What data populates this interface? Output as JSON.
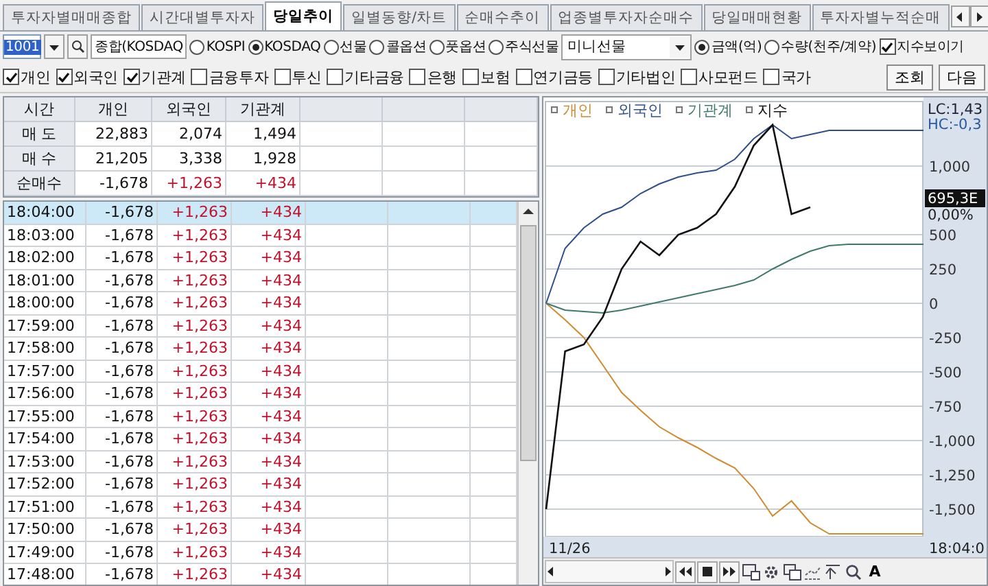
{
  "tabs": [
    {
      "label": "투자자별매매종합",
      "selected": false
    },
    {
      "label": "시간대별투자자",
      "selected": false
    },
    {
      "label": "당일추이",
      "selected": true
    },
    {
      "label": "일별동향/차트",
      "selected": false
    },
    {
      "label": "순매수추이",
      "selected": false
    },
    {
      "label": "업종별투자자순매수",
      "selected": false
    },
    {
      "label": "당일매매현황",
      "selected": false
    },
    {
      "label": "투자자별누적순매",
      "selected": false
    }
  ],
  "query": {
    "code": "1001",
    "market_name": "종합(KOSDAQ",
    "markets": [
      {
        "label": "KOSPI",
        "selected": false
      },
      {
        "label": "KOSDAQ",
        "selected": true
      },
      {
        "label": "선물",
        "selected": false
      },
      {
        "label": "콜옵션",
        "selected": false
      },
      {
        "label": "풋옵션",
        "selected": false
      },
      {
        "label": "주식선물",
        "selected": false
      }
    ],
    "product": "미니선물",
    "units": [
      {
        "label": "금액(억)",
        "selected": true
      },
      {
        "label": "수량(천주/계약)",
        "selected": false
      }
    ],
    "show_index": {
      "label": "지수보이기",
      "checked": true
    }
  },
  "investors": [
    {
      "label": "개인",
      "checked": true
    },
    {
      "label": "외국인",
      "checked": true
    },
    {
      "label": "기관계",
      "checked": true
    },
    {
      "label": "금융투자",
      "checked": false
    },
    {
      "label": "투신",
      "checked": false
    },
    {
      "label": "기타금융",
      "checked": false
    },
    {
      "label": "은행",
      "checked": false
    },
    {
      "label": "보험",
      "checked": false
    },
    {
      "label": "연기금등",
      "checked": false
    },
    {
      "label": "기타법인",
      "checked": false
    },
    {
      "label": "사모펀드",
      "checked": false
    },
    {
      "label": "국가",
      "checked": false
    }
  ],
  "buttons": [
    "조회",
    "다음"
  ],
  "summary": {
    "columns": [
      "시간",
      "개인",
      "외국인",
      "기관계"
    ],
    "rows": [
      {
        "label": "매 도",
        "values": [
          {
            "text": "22,883",
            "color": "#111111"
          },
          {
            "text": "2,074",
            "color": "#111111"
          },
          {
            "text": "1,494",
            "color": "#111111"
          }
        ]
      },
      {
        "label": "매 수",
        "values": [
          {
            "text": "21,205",
            "color": "#111111"
          },
          {
            "text": "3,338",
            "color": "#111111"
          },
          {
            "text": "1,928",
            "color": "#111111"
          }
        ]
      },
      {
        "label": "순매수",
        "values": [
          {
            "text": "-1,678",
            "color": "#111111"
          },
          {
            "text": "+1,263",
            "color": "#c0102a"
          },
          {
            "text": "+434",
            "color": "#c0102a"
          }
        ]
      }
    ]
  },
  "timeline": [
    {
      "time": "18:04:00",
      "selected": true,
      "values": [
        {
          "text": "-1,678",
          "color": "#111111"
        },
        {
          "text": "+1,263",
          "color": "#c0102a"
        },
        {
          "text": "+434",
          "color": "#c0102a"
        }
      ]
    },
    {
      "time": "18:03:00",
      "selected": false,
      "values": [
        {
          "text": "-1,678",
          "color": "#111111"
        },
        {
          "text": "+1,263",
          "color": "#c0102a"
        },
        {
          "text": "+434",
          "color": "#c0102a"
        }
      ]
    },
    {
      "time": "18:02:00",
      "selected": false,
      "values": [
        {
          "text": "-1,678",
          "color": "#111111"
        },
        {
          "text": "+1,263",
          "color": "#c0102a"
        },
        {
          "text": "+434",
          "color": "#c0102a"
        }
      ]
    },
    {
      "time": "18:01:00",
      "selected": false,
      "values": [
        {
          "text": "-1,678",
          "color": "#111111"
        },
        {
          "text": "+1,263",
          "color": "#c0102a"
        },
        {
          "text": "+434",
          "color": "#c0102a"
        }
      ]
    },
    {
      "time": "18:00:00",
      "selected": false,
      "values": [
        {
          "text": "-1,678",
          "color": "#111111"
        },
        {
          "text": "+1,263",
          "color": "#c0102a"
        },
        {
          "text": "+434",
          "color": "#c0102a"
        }
      ]
    },
    {
      "time": "17:59:00",
      "selected": false,
      "values": [
        {
          "text": "-1,678",
          "color": "#111111"
        },
        {
          "text": "+1,263",
          "color": "#c0102a"
        },
        {
          "text": "+434",
          "color": "#c0102a"
        }
      ]
    },
    {
      "time": "17:58:00",
      "selected": false,
      "values": [
        {
          "text": "-1,678",
          "color": "#111111"
        },
        {
          "text": "+1,263",
          "color": "#c0102a"
        },
        {
          "text": "+434",
          "color": "#c0102a"
        }
      ]
    },
    {
      "time": "17:57:00",
      "selected": false,
      "values": [
        {
          "text": "-1,678",
          "color": "#111111"
        },
        {
          "text": "+1,263",
          "color": "#c0102a"
        },
        {
          "text": "+434",
          "color": "#c0102a"
        }
      ]
    },
    {
      "time": "17:56:00",
      "selected": false,
      "values": [
        {
          "text": "-1,678",
          "color": "#111111"
        },
        {
          "text": "+1,263",
          "color": "#c0102a"
        },
        {
          "text": "+434",
          "color": "#c0102a"
        }
      ]
    },
    {
      "time": "17:55:00",
      "selected": false,
      "values": [
        {
          "text": "-1,678",
          "color": "#111111"
        },
        {
          "text": "+1,263",
          "color": "#c0102a"
        },
        {
          "text": "+434",
          "color": "#c0102a"
        }
      ]
    },
    {
      "time": "17:54:00",
      "selected": false,
      "values": [
        {
          "text": "-1,678",
          "color": "#111111"
        },
        {
          "text": "+1,263",
          "color": "#c0102a"
        },
        {
          "text": "+434",
          "color": "#c0102a"
        }
      ]
    },
    {
      "time": "17:53:00",
      "selected": false,
      "values": [
        {
          "text": "-1,678",
          "color": "#111111"
        },
        {
          "text": "+1,263",
          "color": "#c0102a"
        },
        {
          "text": "+434",
          "color": "#c0102a"
        }
      ]
    },
    {
      "time": "17:52:00",
      "selected": false,
      "values": [
        {
          "text": "-1,678",
          "color": "#111111"
        },
        {
          "text": "+1,263",
          "color": "#c0102a"
        },
        {
          "text": "+434",
          "color": "#c0102a"
        }
      ]
    },
    {
      "time": "17:51:00",
      "selected": false,
      "values": [
        {
          "text": "-1,678",
          "color": "#111111"
        },
        {
          "text": "+1,263",
          "color": "#c0102a"
        },
        {
          "text": "+434",
          "color": "#c0102a"
        }
      ]
    },
    {
      "time": "17:50:00",
      "selected": false,
      "values": [
        {
          "text": "-1,678",
          "color": "#111111"
        },
        {
          "text": "+1,263",
          "color": "#c0102a"
        },
        {
          "text": "+434",
          "color": "#c0102a"
        }
      ]
    },
    {
      "time": "17:49:00",
      "selected": false,
      "values": [
        {
          "text": "-1,678",
          "color": "#111111"
        },
        {
          "text": "+1,263",
          "color": "#c0102a"
        },
        {
          "text": "+434",
          "color": "#c0102a"
        }
      ]
    },
    {
      "time": "17:48:00",
      "selected": false,
      "values": [
        {
          "text": "-1,678",
          "color": "#111111"
        },
        {
          "text": "+1,263",
          "color": "#c0102a"
        },
        {
          "text": "+434",
          "color": "#c0102a"
        }
      ]
    }
  ],
  "chart": {
    "lc": "LC:1,43",
    "hc": "HC:-0,3",
    "index_value": "695,3E",
    "index_change": "0,00%",
    "start_label": "11/26",
    "end_label": "18:04:0",
    "font_button": "A",
    "chart_data": {
      "type": "line",
      "grid": true,
      "ylim": [
        -1700,
        1470
      ],
      "yticks": [
        {
          "value": 1000,
          "label": "1,000"
        },
        {
          "value": 500,
          "label": "500"
        },
        {
          "value": 250,
          "label": "250"
        },
        {
          "value": 0,
          "label": "0"
        },
        {
          "value": -250,
          "label": "-250"
        },
        {
          "value": -500,
          "label": "-500"
        },
        {
          "value": -750,
          "label": "-750"
        },
        {
          "value": -1000,
          "label": "-1,000"
        },
        {
          "value": -1250,
          "label": "-1,250"
        },
        {
          "value": -1500,
          "label": "-1,500"
        }
      ],
      "series": [
        {
          "name": "개인",
          "color": "#d08a30",
          "values": [
            0,
            -120,
            -250,
            -450,
            -650,
            -780,
            -900,
            -980,
            -1050,
            -1130,
            -1200,
            -1350,
            -1550,
            -1440,
            -1600,
            -1680,
            -1680,
            -1680,
            -1680,
            -1680,
            -1680
          ]
        },
        {
          "name": "외국인",
          "color": "#2e4f8a",
          "values": [
            0,
            400,
            550,
            650,
            700,
            800,
            870,
            920,
            950,
            970,
            1050,
            1200,
            1300,
            1200,
            1230,
            1260,
            1260,
            1260,
            1260,
            1260,
            1260
          ]
        },
        {
          "name": "기관계",
          "color": "#3d7a6c",
          "values": [
            0,
            -50,
            -60,
            -70,
            -50,
            -20,
            10,
            40,
            70,
            100,
            130,
            170,
            250,
            320,
            380,
            420,
            430,
            430,
            430,
            430,
            430
          ]
        },
        {
          "name": "지수",
          "color": "#111111",
          "values": [
            -1500,
            -350,
            -300,
            -100,
            250,
            450,
            350,
            500,
            550,
            650,
            850,
            1150,
            1300,
            650,
            700,
            null,
            null,
            null,
            null,
            null,
            null
          ]
        }
      ]
    }
  }
}
